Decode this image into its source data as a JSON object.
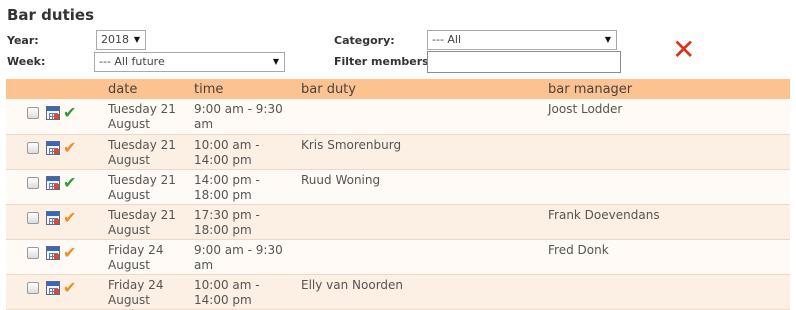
{
  "page": {
    "title": "Bar duties"
  },
  "filters": {
    "year_label": "Year:",
    "year_value": "2018",
    "week_label": "Week:",
    "week_value": "--- All future",
    "category_label": "Category:",
    "category_value": "--- All",
    "filter_members_label": "Filter members:",
    "filter_members_value": ""
  },
  "icons": {
    "dropdown_arrow": "▼",
    "clear_filter": "✕",
    "check": "✔"
  },
  "colors": {
    "header_bg": "#fcc290",
    "confirmed": "#2e9e35",
    "unconfirmed": "#f08c1e",
    "clear_icon": "#d9341c"
  },
  "table": {
    "columns": [
      "date",
      "time",
      "bar duty",
      "bar manager"
    ],
    "rows": [
      {
        "date": "Tuesday 21 August",
        "time": "9:00 am - 9:30 am",
        "bar_duty": "",
        "bar_manager": "Joost Lodder",
        "status": "confirmed"
      },
      {
        "date": "Tuesday 21 August",
        "time": "10:00 am - 14:00 pm",
        "bar_duty": "Kris Smorenburg",
        "bar_manager": "",
        "status": "pending"
      },
      {
        "date": "Tuesday 21 August",
        "time": "14:00 pm - 18:00 pm",
        "bar_duty": "Ruud Woning",
        "bar_manager": "",
        "status": "confirmed"
      },
      {
        "date": "Tuesday 21 August",
        "time": "17:30 pm - 18:00 pm",
        "bar_duty": "",
        "bar_manager": "Frank Doevendans",
        "status": "pending"
      },
      {
        "date": "Friday 24 August",
        "time": "9:00 am - 9:30 am",
        "bar_duty": "",
        "bar_manager": "Fred Donk",
        "status": "pending"
      },
      {
        "date": "Friday 24 August",
        "time": "10:00 am - 14:00 pm",
        "bar_duty": "Elly van Noorden",
        "bar_manager": "",
        "status": "pending"
      }
    ]
  }
}
